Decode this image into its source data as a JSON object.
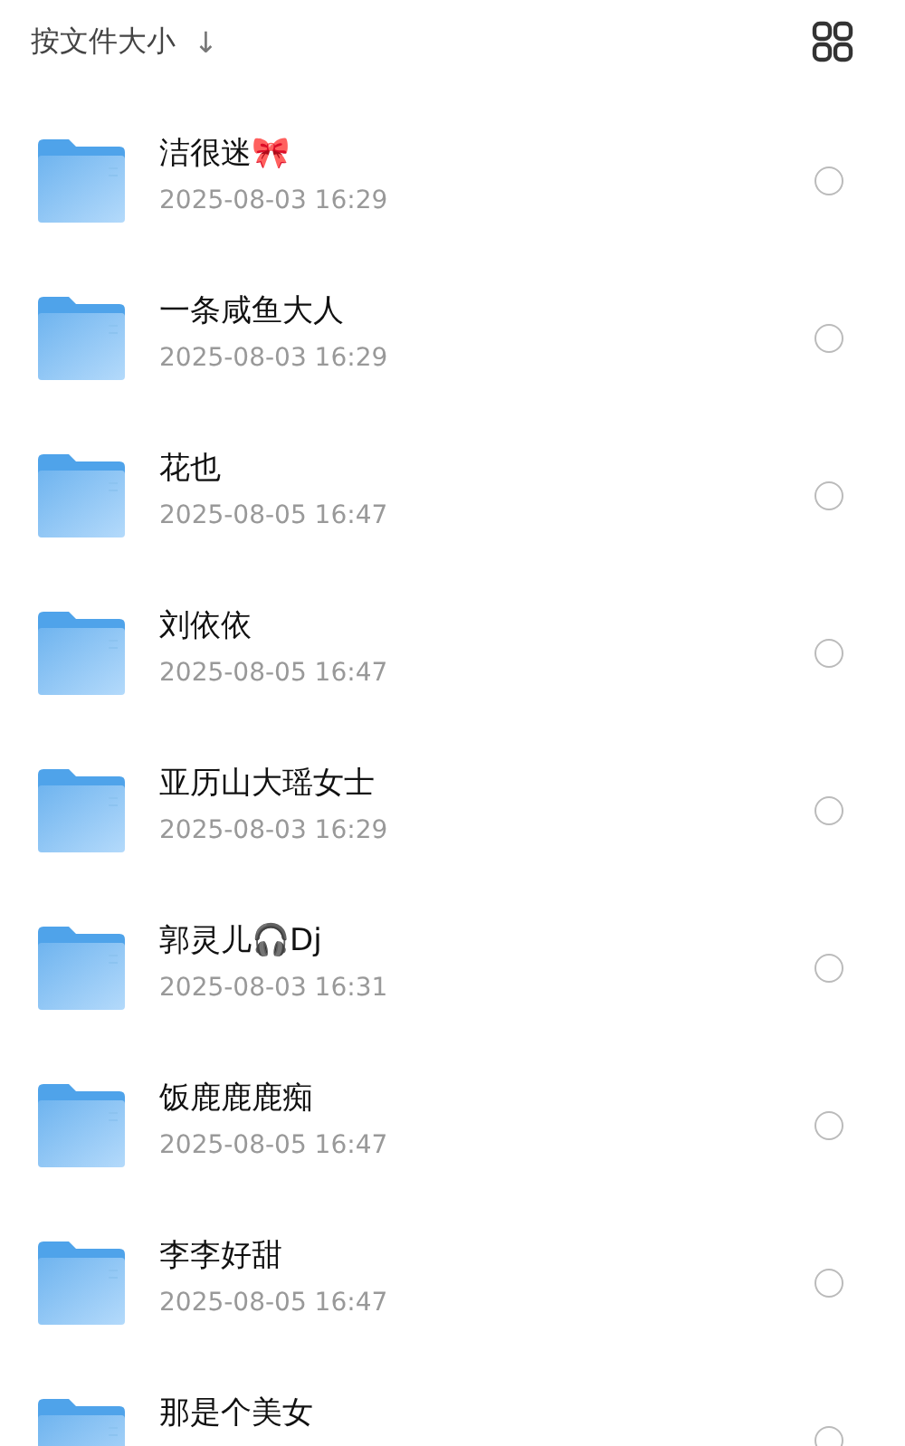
{
  "sort": {
    "label": "按文件大小",
    "arrow": "↓"
  },
  "items": [
    {
      "name": "洁很迷🎀",
      "date": "2025-08-03 16:29",
      "selected": false
    },
    {
      "name": "一条咸鱼大人",
      "date": "2025-08-03 16:29",
      "selected": false
    },
    {
      "name": "花也",
      "date": "2025-08-05 16:47",
      "selected": false
    },
    {
      "name": "刘依依",
      "date": "2025-08-05 16:47",
      "selected": false
    },
    {
      "name": "亚历山大瑶女士",
      "date": "2025-08-03 16:29",
      "selected": false
    },
    {
      "name": "郭灵儿🎧Dj",
      "date": "2025-08-03 16:31",
      "selected": false
    },
    {
      "name": "饭鹿鹿鹿痴",
      "date": "2025-08-05 16:47",
      "selected": false
    },
    {
      "name": "李李好甜",
      "date": "2025-08-05 16:47",
      "selected": false
    },
    {
      "name": "那是个美女",
      "selected": false
    }
  ]
}
